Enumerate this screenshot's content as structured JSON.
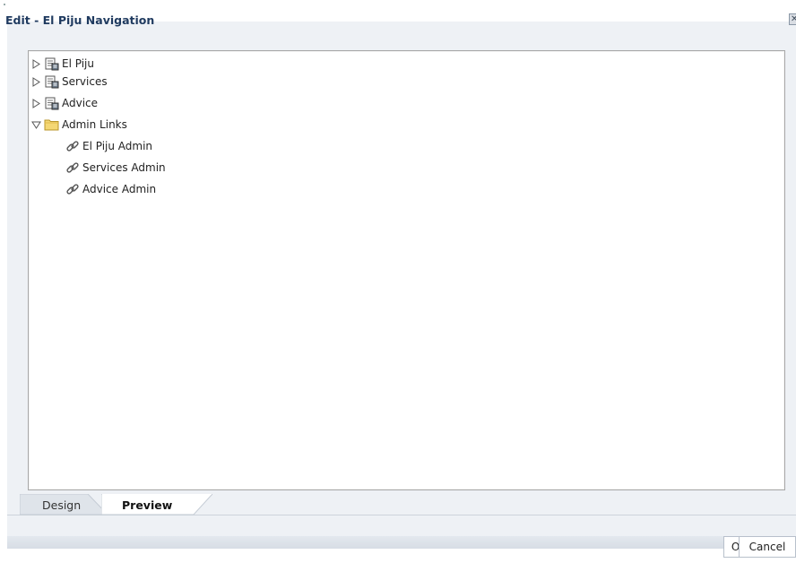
{
  "dialog": {
    "title": "Edit - El Piju Navigation",
    "close_icon": "close-icon"
  },
  "tree": {
    "items": [
      {
        "label": "El Piju",
        "type": "page-group",
        "expanded": false,
        "level": 0,
        "icon": "page-group-icon"
      },
      {
        "label": "Services",
        "type": "page-group",
        "expanded": false,
        "level": 0,
        "icon": "page-group-icon"
      },
      {
        "label": "Advice",
        "type": "page-group",
        "expanded": false,
        "level": 0,
        "icon": "page-group-icon"
      },
      {
        "label": "Admin Links",
        "type": "folder",
        "expanded": true,
        "level": 0,
        "icon": "folder-icon"
      },
      {
        "label": "El Piju Admin",
        "type": "link",
        "level": 1,
        "icon": "link-icon"
      },
      {
        "label": "Services Admin",
        "type": "link",
        "level": 1,
        "icon": "link-icon"
      },
      {
        "label": "Advice Admin",
        "type": "link",
        "level": 1,
        "icon": "link-icon"
      }
    ]
  },
  "tabs": [
    {
      "label": "Design",
      "selected": false
    },
    {
      "label": "Preview",
      "selected": true
    }
  ],
  "buttons": {
    "ok": "OK",
    "cancel": "Cancel"
  },
  "colors": {
    "title": "#1f3a5f",
    "folder": "#f4d774",
    "border": "#a8a8a8"
  }
}
